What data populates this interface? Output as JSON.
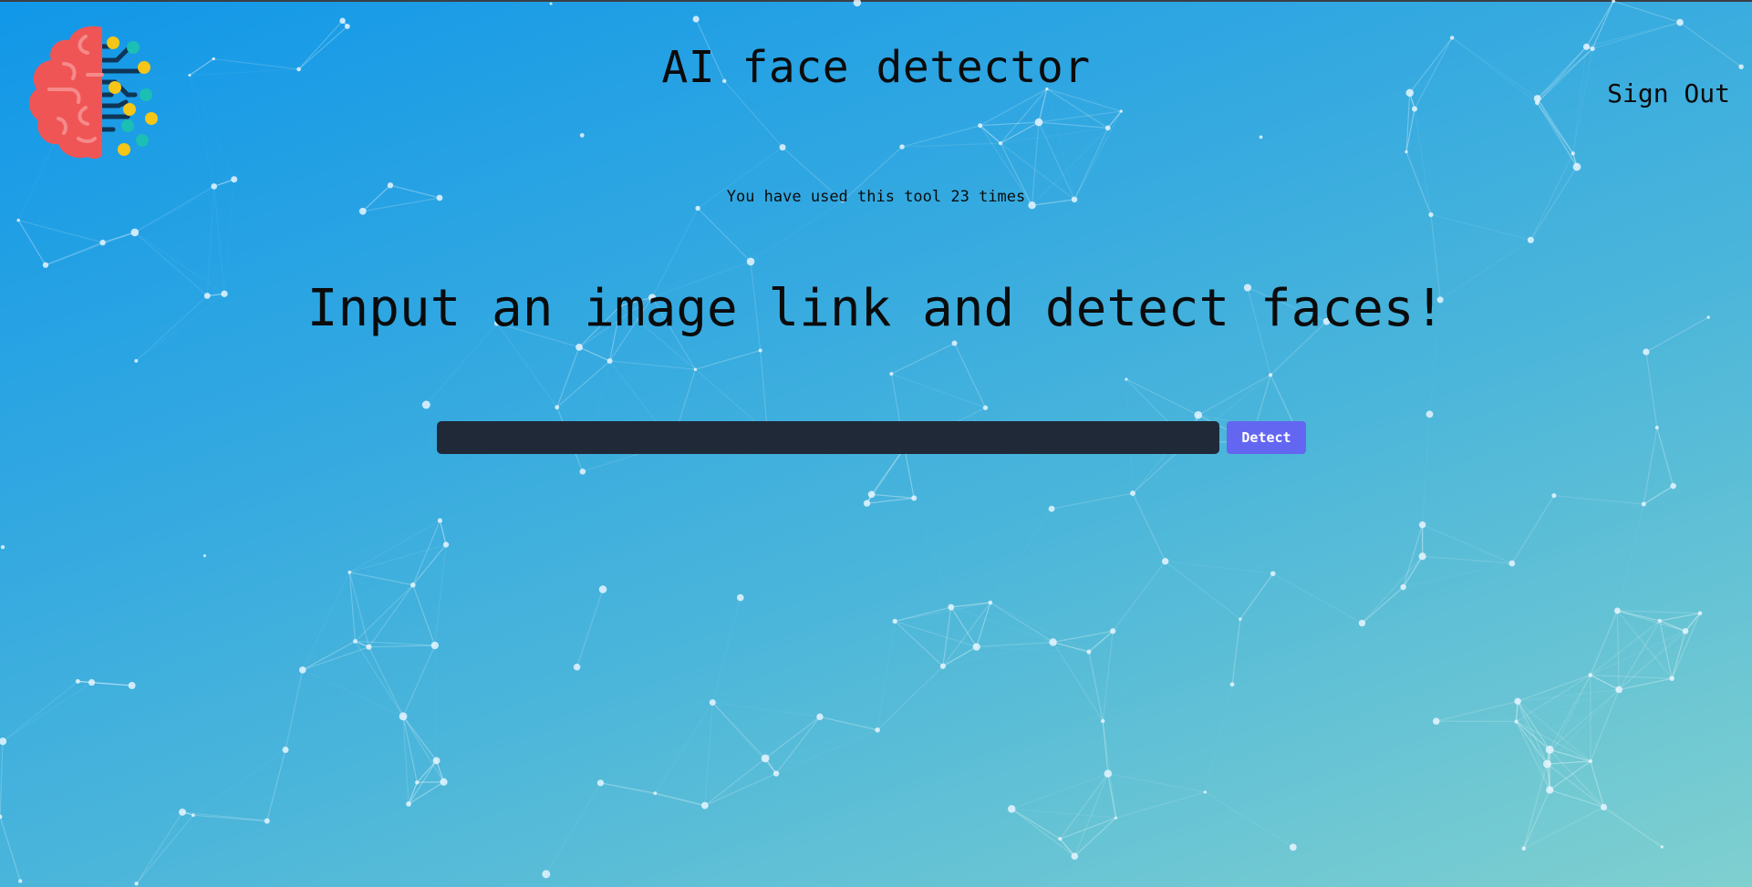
{
  "app": {
    "title": "AI face detector",
    "logo_icon": "brain-circuit-logo-icon"
  },
  "nav": {
    "sign_out_label": "Sign Out"
  },
  "usage": {
    "text": "You have used this tool 23 times"
  },
  "main": {
    "heading": "Input an image link and detect faces!",
    "url_input": {
      "value": "",
      "placeholder": ""
    },
    "detect_label": "Detect"
  },
  "colors": {
    "background_top": "#1197e8",
    "background_bottom": "#7fd0cf",
    "input_background": "#1f2937",
    "button_accent": "#6366f1",
    "brain_red": "#f05555",
    "circuit_yellow": "#f5c518",
    "circuit_teal": "#1bbfb4",
    "circuit_navy": "#0f3557"
  }
}
